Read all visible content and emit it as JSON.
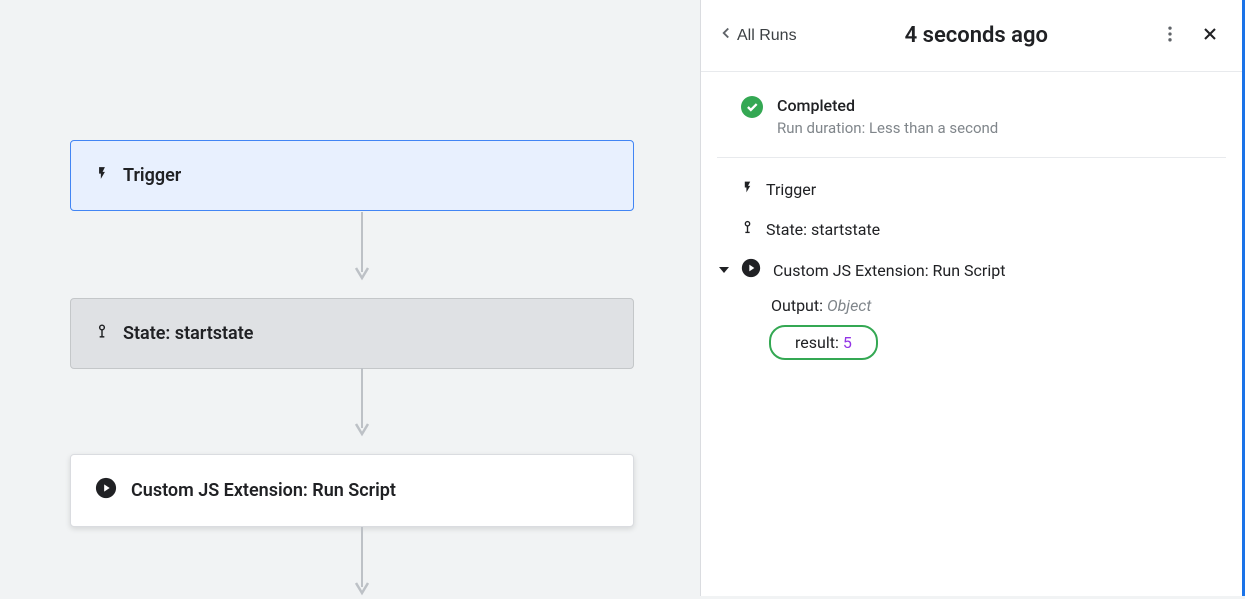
{
  "canvas": {
    "nodes": {
      "trigger": "Trigger",
      "state": "State: startstate",
      "script": "Custom JS Extension: Run Script"
    }
  },
  "panel": {
    "back_label": "All Runs",
    "title": "4 seconds ago",
    "status": {
      "title": "Completed",
      "subtitle": "Run duration: Less than a second"
    },
    "steps": {
      "trigger": "Trigger",
      "state": "State: startstate",
      "script": "Custom JS Extension: Run Script"
    },
    "output": {
      "label": "Output:",
      "type": "Object",
      "result_key": "result:",
      "result_value": "5"
    }
  }
}
